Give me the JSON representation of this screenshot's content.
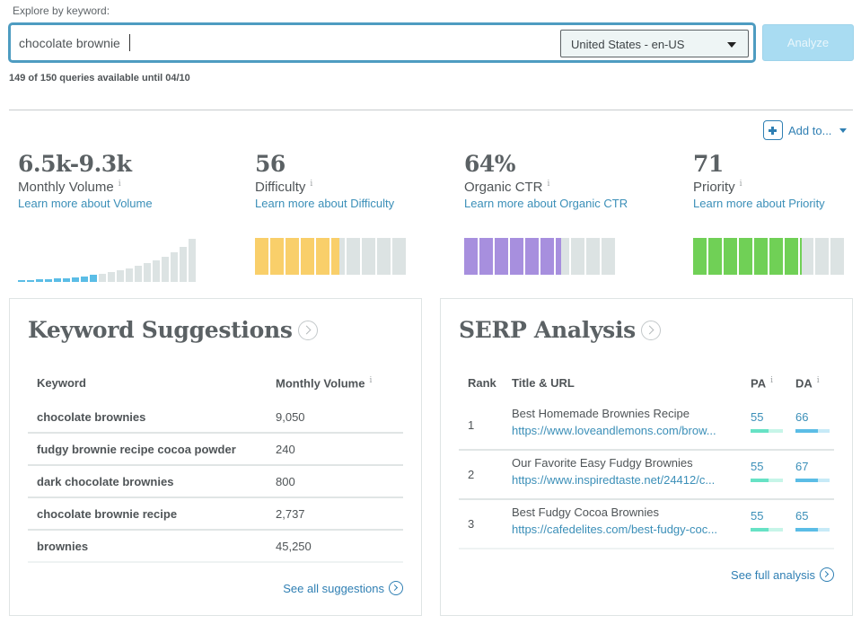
{
  "search": {
    "label": "Explore by keyword:",
    "value": "chocolate brownie",
    "locale": "United States - en-US",
    "analyze_label": "Analyze",
    "queries_status": "149 of 150 queries available until 04/10"
  },
  "add_to": {
    "label": "Add to..."
  },
  "metrics": [
    {
      "value": "6.5k-9.3k",
      "label": "Monthly Volume",
      "info": "i",
      "link": "Learn more about Volume"
    },
    {
      "value": "56",
      "label": "Difficulty",
      "info": "i",
      "link": "Learn more about Difficulty",
      "score": 56,
      "color": "#f9cf6a"
    },
    {
      "value": "64%",
      "label": "Organic CTR",
      "info": "i",
      "link": "Learn more about Organic CTR",
      "score": 64,
      "color": "#a78fde"
    },
    {
      "value": "71",
      "label": "Priority",
      "info": "i",
      "link": "Learn more about Priority",
      "score": 71,
      "color": "#70d056"
    }
  ],
  "volume_histogram": {
    "relative_heights": [
      2,
      2,
      3,
      3,
      4,
      4,
      5,
      6,
      8,
      9,
      11,
      13,
      15,
      18,
      21,
      24,
      28,
      33,
      39,
      48
    ],
    "highlighted_count": 9,
    "highlight_color": "#5bbde6",
    "base_color": "#dce3e3"
  },
  "keyword_suggestions": {
    "title": "Keyword Suggestions",
    "columns": [
      "Keyword",
      "Monthly Volume"
    ],
    "volume_info": "i",
    "rows": [
      {
        "keyword": "chocolate brownies",
        "volume": "9,050"
      },
      {
        "keyword": "fudgy brownie recipe cocoa powder",
        "volume": "240"
      },
      {
        "keyword": "dark chocolate brownies",
        "volume": "800"
      },
      {
        "keyword": "chocolate brownie recipe",
        "volume": "2,737"
      },
      {
        "keyword": "brownies",
        "volume": "45,250"
      }
    ],
    "see_all": "See all suggestions"
  },
  "serp_analysis": {
    "title": "SERP Analysis",
    "columns": [
      "Rank",
      "Title & URL",
      "PA",
      "DA"
    ],
    "info": "i",
    "rows": [
      {
        "rank": "1",
        "title": "Best Homemade Brownies Recipe",
        "url": "https://www.loveandlemons.com/brow...",
        "pa": "55",
        "da": "66"
      },
      {
        "rank": "2",
        "title": "Our Favorite Easy Fudgy Brownies",
        "url": "https://www.inspiredtaste.net/24412/c...",
        "pa": "55",
        "da": "67"
      },
      {
        "rank": "3",
        "title": "Best Fudgy Cocoa Brownies",
        "url": "https://cafedelites.com/best-fudgy-coc...",
        "pa": "55",
        "da": "65"
      }
    ],
    "see_full": "See full analysis"
  }
}
